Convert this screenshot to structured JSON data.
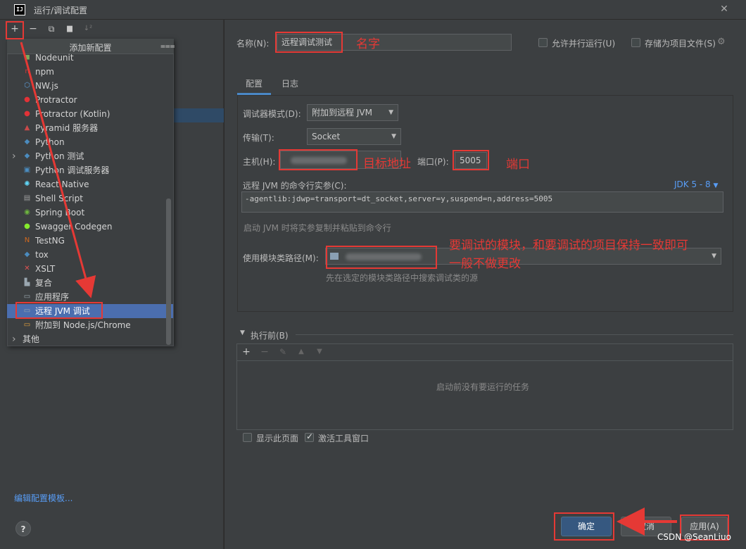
{
  "window": {
    "title": "运行/调试配置",
    "logo_text": "IJ",
    "close_glyph": "✕"
  },
  "left_toolbar": {
    "add": "+",
    "remove": "−",
    "copy": "⧉",
    "folder": "▆",
    "sort": "↓²"
  },
  "popup": {
    "title": "添加新配置",
    "filter_icon": "filter-icon",
    "items": [
      {
        "label": "Nodeunit",
        "icon": "nodeunit-icon",
        "color": "#7aab5c",
        "glyph": "◼"
      },
      {
        "label": "npm",
        "icon": "npm-icon",
        "color": "#cb3837",
        "glyph": "n"
      },
      {
        "label": "NW.js",
        "icon": "nwjs-icon",
        "color": "#5d9bd6",
        "glyph": "⬡"
      },
      {
        "label": "Protractor",
        "icon": "protractor-icon",
        "color": "#e23237",
        "glyph": "●"
      },
      {
        "label": "Protractor (Kotlin)",
        "icon": "protractor-kotlin-icon",
        "color": "#e23237",
        "glyph": "●"
      },
      {
        "label": "Pyramid 服务器",
        "icon": "pyramid-icon",
        "color": "#c94a4a",
        "glyph": "▲"
      },
      {
        "label": "Python",
        "icon": "python-icon",
        "color": "#4b8bbe",
        "glyph": "◆"
      },
      {
        "label": "Python 测试",
        "icon": "python-test-icon",
        "color": "#4b8bbe",
        "glyph": "◆",
        "expandable": true
      },
      {
        "label": "Python 调试服务器",
        "icon": "python-debug-server-icon",
        "color": "#4b8bbe",
        "glyph": "▣"
      },
      {
        "label": "React Native",
        "icon": "react-icon",
        "color": "#61dafb",
        "glyph": "✺"
      },
      {
        "label": "Shell Script",
        "icon": "shell-icon",
        "color": "#9e9e9e",
        "glyph": "▤"
      },
      {
        "label": "Spring Boot",
        "icon": "spring-icon",
        "color": "#6db33f",
        "glyph": "◉"
      },
      {
        "label": "Swagger Codegen",
        "icon": "swagger-icon",
        "color": "#85ea2d",
        "glyph": "●"
      },
      {
        "label": "TestNG",
        "icon": "testng-icon",
        "color": "#d2691e",
        "glyph": "N"
      },
      {
        "label": "tox",
        "icon": "tox-icon",
        "color": "#4b8bbe",
        "glyph": "◆"
      },
      {
        "label": "XSLT",
        "icon": "xslt-icon",
        "color": "#e05252",
        "glyph": "✕"
      },
      {
        "label": "复合",
        "icon": "compound-icon",
        "color": "#9aa7b0",
        "glyph": "▙"
      },
      {
        "label": "应用程序",
        "icon": "application-icon",
        "color": "#9aa7b0",
        "glyph": "▭"
      },
      {
        "label": "远程 JVM 调试",
        "icon": "remote-jvm-icon",
        "color": "#9aa7b0",
        "glyph": "▭",
        "selected": true
      },
      {
        "label": "附加到 Node.js/Chrome",
        "icon": "nodejs-attach-icon",
        "color": "#e6a33a",
        "glyph": "▭"
      },
      {
        "label": "其他",
        "icon": "other-icon",
        "color": "#aaaaaa",
        "glyph": "",
        "expandable": true
      }
    ]
  },
  "left_footer": {
    "edit_templates": "编辑配置模板...",
    "help": "?"
  },
  "form": {
    "name_label": "名称(N):",
    "name_value": "远程调试测试",
    "allow_parallel": "允许并行运行(U)",
    "store_as_file": "存储为项目文件(S)",
    "tabs": [
      "配置",
      "日志"
    ],
    "debugger_mode_label": "调试器模式(D):",
    "debugger_mode_value": "附加到远程 JVM",
    "transport_label": "传输(T):",
    "transport_value": "Socket",
    "host_label": "主机(H):",
    "port_label": "端口(P):",
    "port_value": "5005",
    "cmd_label": "远程 JVM 的命令行实参(C):",
    "jdk_link": "JDK 5 - 8",
    "cmd_value": "-agentlib:jdwp=transport=dt_socket,server=y,suspend=n,address=5005",
    "cmd_hint": "启动 JVM 时将实参复制并粘贴到命令行",
    "module_label": "使用模块类路径(M):",
    "module_hint": "先在选定的模块类路径中搜索调试类的源",
    "before_launch_title": "执行前(B)",
    "before_launch_empty": "启动前没有要运行的任务",
    "show_page": "显示此页面",
    "activate_tool_window": "激活工具窗口"
  },
  "buttons": {
    "ok": "确定",
    "cancel": "取消",
    "apply": "应用(A)"
  },
  "annotations": {
    "name": "名字",
    "host": "目标地址",
    "port": "端口",
    "module_line1": "要调试的模块，和要调试的项目保持一致即可",
    "module_line2": "一般不做更改"
  },
  "watermark": "CSDN @SeanLiuo",
  "colors": {
    "accent": "#4a88c7",
    "annotation": "#e53935",
    "selection": "#4b6eaf"
  }
}
